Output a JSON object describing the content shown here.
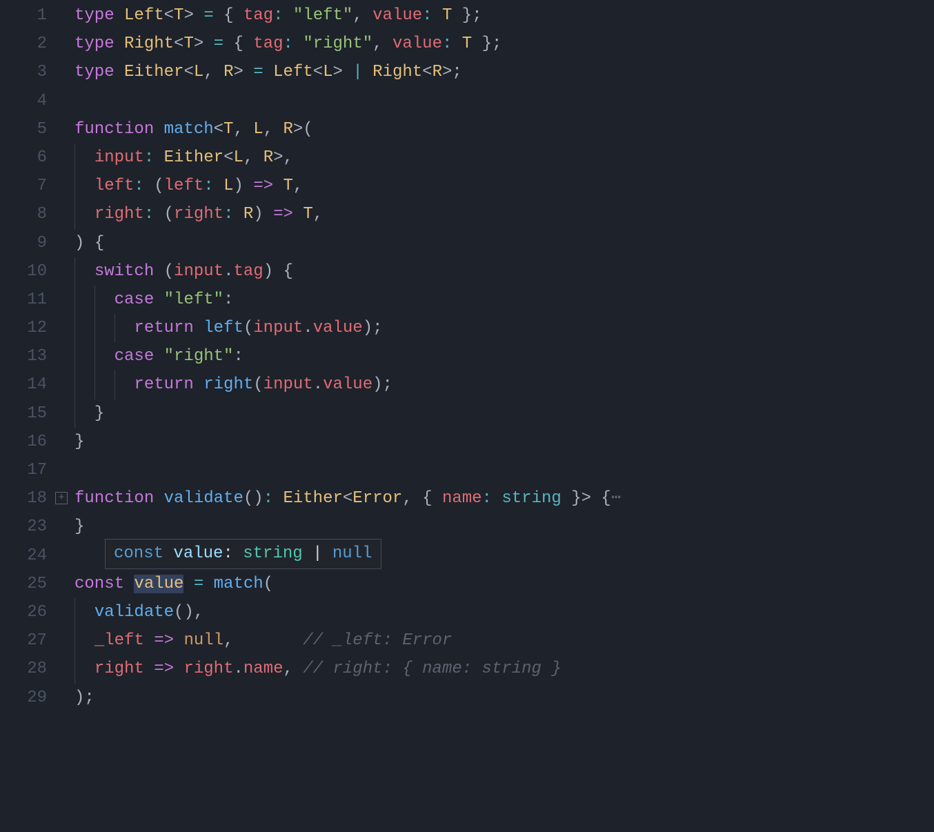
{
  "tooltip": {
    "kw": "const",
    "name": "value",
    "colon": ": ",
    "type": "string",
    "bar": " | ",
    "null": "null"
  },
  "lineNumbers": [
    "1",
    "2",
    "3",
    "4",
    "5",
    "6",
    "7",
    "8",
    "9",
    "10",
    "11",
    "12",
    "13",
    "14",
    "15",
    "16",
    "17",
    "18",
    "23",
    "24",
    "25",
    "26",
    "27",
    "28",
    "29"
  ],
  "tokens": {
    "type": "type",
    "Left": "Left",
    "Right": "Right",
    "Either": "Either",
    "T": "T",
    "L": "L",
    "R": "R",
    "tag": "tag",
    "value": "value",
    "leftStr": "\"left\"",
    "rightStr": "\"right\"",
    "function": "function",
    "match": "match",
    "input": "input",
    "leftParam": "left",
    "rightParam": "right",
    "switch": "switch",
    "case": "case",
    "return": "return",
    "validate": "validate",
    "Error": "Error",
    "name": "name",
    "string": "string",
    "const": "const",
    "null": "null",
    "_left": "_left",
    "arrow": "=>",
    "eq": "=",
    "lt": "<",
    "gt": ">",
    "bar": "|",
    "colon": ":",
    "comma": ",",
    "semi": ";",
    "lparen": "(",
    "rparen": ")",
    "lbrace": "{",
    "rbrace": "}",
    "dot": ".",
    "ellipsis": "⋯",
    "cmt_left": "// _left: Error",
    "cmt_right": "// right: { name: string }",
    "foldIcon": "+"
  }
}
